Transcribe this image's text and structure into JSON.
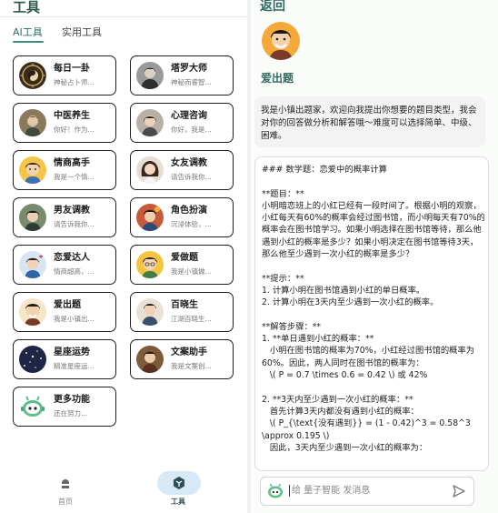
{
  "left_panel": {
    "title": "工具",
    "tabs": [
      {
        "label": "AI工具",
        "active": true
      },
      {
        "label": "实用工具",
        "active": false
      }
    ],
    "cards": [
      {
        "title": "每日一卦",
        "desc": "神秘占卜师...",
        "avatar": "bagua-avatar"
      },
      {
        "title": "塔罗大师",
        "desc": "神秘而睿智...",
        "avatar": "tarot-master-avatar"
      },
      {
        "title": "中医养生",
        "desc": "你好！作为...",
        "avatar": "tcm-doctor-avatar"
      },
      {
        "title": "心理咨询",
        "desc": "你好，我是...",
        "avatar": "counselor-avatar"
      },
      {
        "title": "情商高手",
        "desc": "我是一个情...",
        "avatar": "eq-master-avatar"
      },
      {
        "title": "女友调教",
        "desc": "请告诉我你...",
        "avatar": "girlfriend-avatar"
      },
      {
        "title": "男友调教",
        "desc": "请告诉我你...",
        "avatar": "boyfriend-avatar"
      },
      {
        "title": "角色扮演",
        "desc": "沉浸体验，...",
        "avatar": "roleplay-avatar"
      },
      {
        "title": "恋爱达人",
        "desc": "情商超高，...",
        "avatar": "love-expert-avatar"
      },
      {
        "title": "爱做题",
        "desc": "我是小镇做...",
        "avatar": "quiz-solver-avatar"
      },
      {
        "title": "爱出题",
        "desc": "我是小镇出...",
        "avatar": "quiz-maker-avatar"
      },
      {
        "title": "百晓生",
        "desc": "江湖百晓生...",
        "avatar": "baixiaosheng-avatar"
      },
      {
        "title": "星座运势",
        "desc": "精准星座运...",
        "avatar": "horoscope-avatar"
      },
      {
        "title": "文案助手",
        "desc": "我是文案创...",
        "avatar": "copywriter-avatar"
      },
      {
        "title": "更多功能",
        "desc": "还在努力...",
        "avatar": "robot-avatar"
      }
    ],
    "nav": [
      {
        "label": "首页",
        "icon": "home-icon",
        "active": false
      },
      {
        "label": "工具",
        "icon": "tools-icon",
        "active": true
      }
    ]
  },
  "right_panel": {
    "back_label": "返回",
    "bot_name": "爱出题",
    "intro": "我是小镇出题家，欢迎向我提出你想要的题目类型，我会对你的回答做分析和解答哦～难度可以选择简单、中级、困难。",
    "response": "### 数学题：恋爱中的概率计算\n\n**题目：**\n小明暗恋班上的小红已经有一段时间了。根据小明的观察，小红每天有60%的概率会经过图书馆，而小明每天有70%的概率会在图书馆学习。如果小明选择在图书馆等待，那么他遇到小红的概率是多少？如果小明决定在图书馆等待3天，那么他至少遇到一次小红的概率是多少？\n\n**提示：**\n1. 计算小明在图书馆遇到小红的单日概率。\n2. 计算小明在3天内至少遇到一次小红的概率。\n\n**解答步骤：**\n1. **单日遇到小红的概率：**\n   小明在图书馆的概率为70%，小红经过图书馆的概率为60%。因此，两人同时在图书馆的概率为：\n   \\( P = 0.7 \\times 0.6 = 0.42 \\) 或 42%\n\n2. **3天内至少遇到一次小红的概率：**\n   首先计算3天内都没有遇到小红的概率：\n   \\( P_{\\text{没有遇到}} = (1 - 0.42)^3 = 0.58^3 \\approx 0.195 \\)\n   因此，3天内至少遇到一次小红的概率为：",
    "input_placeholder": "给 量子智能 发消息"
  },
  "colors": {
    "accent": "#2f6b60",
    "nav_active_bg": "#d7e9f6"
  }
}
